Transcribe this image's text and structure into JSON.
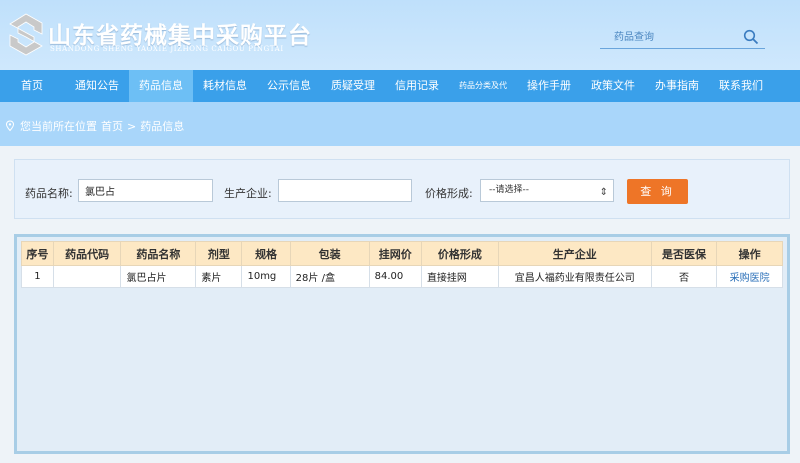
{
  "header": {
    "title": "山东省药械集中采购平台",
    "subtitle": "SHANDONG SHENG YAOXIE JIZHONG CAIGOU PINGTAI",
    "search": {
      "placeholder": "药品查询"
    }
  },
  "nav": {
    "items": [
      {
        "label": "首页"
      },
      {
        "label": "通知公告"
      },
      {
        "label": "药品信息",
        "active": true
      },
      {
        "label": "耗材信息"
      },
      {
        "label": "公示信息"
      },
      {
        "label": "质疑受理"
      },
      {
        "label": "信用记录"
      },
      {
        "label": "药品分类及代"
      },
      {
        "label": "操作手册"
      },
      {
        "label": "政策文件"
      },
      {
        "label": "办事指南"
      },
      {
        "label": "联系我们"
      }
    ]
  },
  "breadcrumb": {
    "prefix": "您当前所在位置",
    "home": "首页",
    "sep": ">",
    "current": "药品信息"
  },
  "filter": {
    "drug_name_label": "药品名称:",
    "drug_name_value": "氯巴占",
    "manufacturer_label": "生产企业:",
    "manufacturer_value": "",
    "price_label": "价格形成:",
    "price_select_value": "--请选择--",
    "query_button": "查 询"
  },
  "table": {
    "headers": [
      "序号",
      "药品代码",
      "药品名称",
      "剂型",
      "规格",
      "包装",
      "挂网价",
      "价格形成",
      "生产企业",
      "是否医保",
      "操作"
    ],
    "rows": [
      [
        "1",
        "",
        "氯巴占片",
        "素片",
        "10mg",
        "28片 /盒",
        "84.00",
        "直接挂网",
        "宜昌人福药业有限责任公司",
        "否",
        "采购医院"
      ]
    ]
  },
  "colors": {
    "nav_bg": "#3aa0ea",
    "nav_active": "#6dbff5",
    "query_button": "#ee7527",
    "table_header": "#fde8c4"
  }
}
